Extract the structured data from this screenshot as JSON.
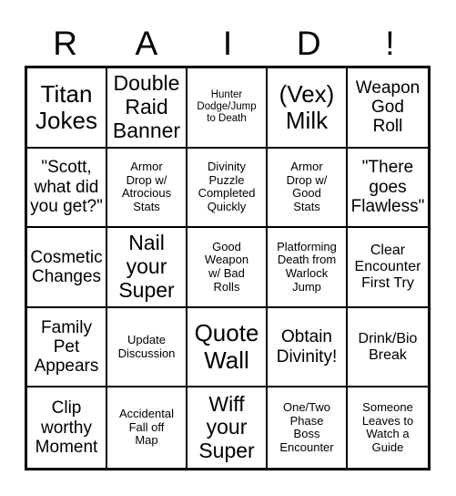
{
  "card": {
    "title_letters": [
      "R",
      "A",
      "I",
      "D",
      "!"
    ],
    "columns": 5,
    "rows": 5,
    "colors": {
      "background": "#ffffff",
      "text": "#000000",
      "border": "#000000"
    },
    "cells": [
      {
        "text": "Titan\nJokes",
        "size": "xl"
      },
      {
        "text": "Double\nRaid\nBanner",
        "size": "lg"
      },
      {
        "text": "Hunter\nDodge/Jump\nto Death",
        "size": "xxs"
      },
      {
        "text": "(Vex)\nMilk",
        "size": "xl"
      },
      {
        "text": "Weapon\nGod\nRoll",
        "size": "md"
      },
      {
        "text": "\"Scott,\nwhat did\nyou get?\"",
        "size": "md"
      },
      {
        "text": "Armor\nDrop w/\nAtrocious\nStats",
        "size": "xs"
      },
      {
        "text": "Divinity\nPuzzle\nCompleted\nQuickly",
        "size": "xs"
      },
      {
        "text": "Armor\nDrop w/\nGood\nStats",
        "size": "xs"
      },
      {
        "text": "\"There\ngoes\nFlawless\"",
        "size": "md"
      },
      {
        "text": "Cosmetic\nChanges",
        "size": "md"
      },
      {
        "text": "Nail\nyour\nSuper",
        "size": "lg"
      },
      {
        "text": "Good\nWeapon\nw/ Bad\nRolls",
        "size": "xs"
      },
      {
        "text": "Platforming\nDeath from\nWarlock\nJump",
        "size": "xs"
      },
      {
        "text": "Clear\nEncounter\nFirst Try",
        "size": "sm"
      },
      {
        "text": "Family\nPet\nAppears",
        "size": "md"
      },
      {
        "text": "Update\nDiscussion",
        "size": "xs"
      },
      {
        "text": "Quote\nWall",
        "size": "xl"
      },
      {
        "text": "Obtain\nDivinity!",
        "size": "md"
      },
      {
        "text": "Drink/Bio\nBreak",
        "size": "sm"
      },
      {
        "text": "Clip\nworthy\nMoment",
        "size": "md"
      },
      {
        "text": "Accidental\nFall off\nMap",
        "size": "xs"
      },
      {
        "text": "Wiff\nyour\nSuper",
        "size": "lg"
      },
      {
        "text": "One/Two\nPhase\nBoss\nEncounter",
        "size": "xs"
      },
      {
        "text": "Someone\nLeaves to\nWatch a\nGuide",
        "size": "xs"
      }
    ]
  }
}
